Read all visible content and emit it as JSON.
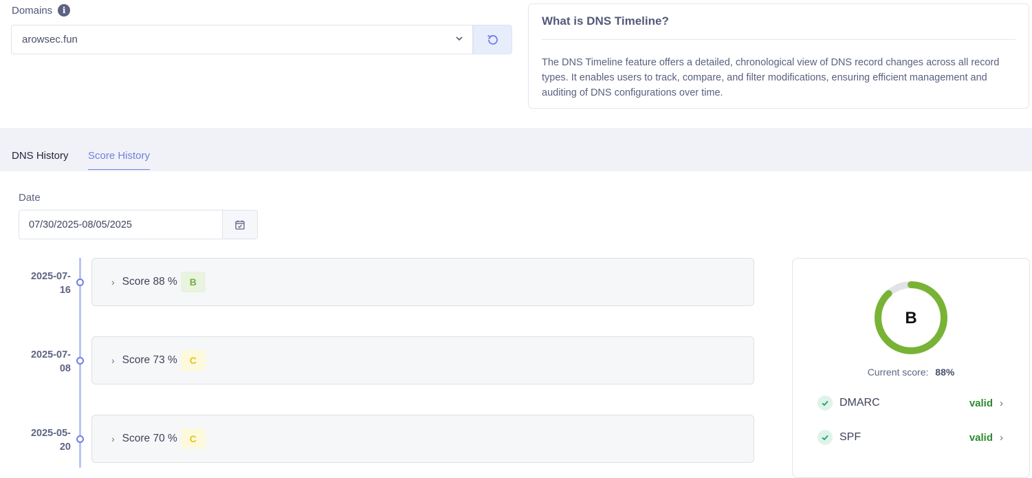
{
  "domains": {
    "label": "Domains",
    "selected": "arowsec.fun"
  },
  "info_card": {
    "title": "What is DNS Timeline?",
    "text": "The DNS Timeline feature offers a detailed, chronological view of DNS record changes across all record types. It enables users to track, compare, and filter modifications, ensuring efficient management and auditing of DNS configurations over time."
  },
  "tabs": [
    {
      "label": "DNS History",
      "active": false
    },
    {
      "label": "Score History",
      "active": true
    }
  ],
  "filter": {
    "date_label": "Date",
    "date_value": "07/30/2025-08/05/2025"
  },
  "timeline": [
    {
      "date_line1": "2025-07-",
      "date_line2": "16",
      "score_label": "Score 88 %",
      "grade": "B"
    },
    {
      "date_line1": "2025-07-",
      "date_line2": "08",
      "score_label": "Score 73 %",
      "grade": "C"
    },
    {
      "date_line1": "2025-05-",
      "date_line2": "20",
      "score_label": "Score 70 %",
      "grade": "C"
    }
  ],
  "score_panel": {
    "grade": "B",
    "current_score_label": "Current score:",
    "current_score_value": "88%",
    "score_fraction": 0.88,
    "ring_color": "#78b336",
    "checks": [
      {
        "name": "DMARC",
        "status": "valid"
      },
      {
        "name": "SPF",
        "status": "valid"
      }
    ]
  },
  "colors": {
    "accent": "#6d7fe3",
    "valid": "#2f8a2f",
    "grade_b": "#74b13f",
    "grade_c": "#e3c520"
  }
}
